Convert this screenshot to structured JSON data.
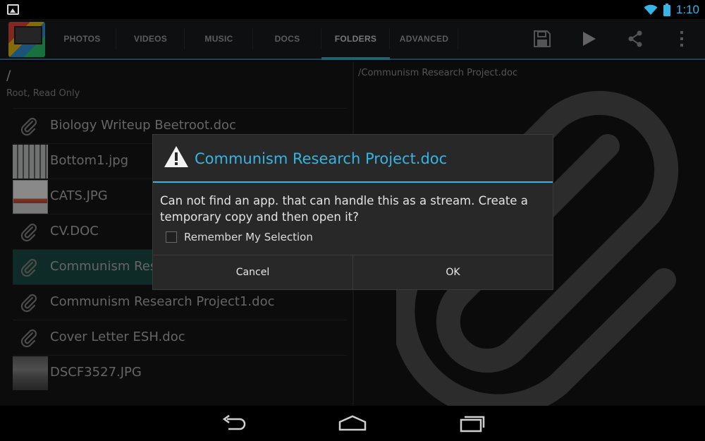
{
  "status_bar": {
    "time": "1:10",
    "icons": [
      "image-notification-icon",
      "wifi-icon",
      "battery-icon"
    ]
  },
  "action_bar": {
    "tabs": [
      {
        "label": "PHOTOS"
      },
      {
        "label": "VIDEOS"
      },
      {
        "label": "MUSIC"
      },
      {
        "label": "DOCS"
      },
      {
        "label": "FOLDERS",
        "active": true
      },
      {
        "label": "ADVANCED"
      }
    ],
    "actions": [
      "save-icon",
      "play-icon",
      "share-icon",
      "overflow-menu-icon"
    ]
  },
  "browser": {
    "path": "/",
    "path_info": "Root, Read Only",
    "files": [
      {
        "name": "Biology Writeup Beetroot.doc",
        "icon": "paperclip-icon"
      },
      {
        "name": "Bottom1.jpg",
        "icon": "thumbnail"
      },
      {
        "name": "CATS.JPG",
        "icon": "thumbnail"
      },
      {
        "name": "CV.DOC",
        "icon": "paperclip-icon"
      },
      {
        "name": "Communism Research Project.doc",
        "icon": "paperclip-icon",
        "selected": true
      },
      {
        "name": "Communism Research Project1.doc",
        "icon": "paperclip-icon"
      },
      {
        "name": "Cover Letter ESH.doc",
        "icon": "paperclip-icon"
      },
      {
        "name": "DSCF3527.JPG",
        "icon": "thumbnail"
      }
    ]
  },
  "preview": {
    "path": "/Communism Research Project.doc"
  },
  "dialog": {
    "title": "Communism Research Project.doc",
    "message": "Can not find an app. that can handle this as a stream. Create a temporary copy and then open it?",
    "remember_label": "Remember My Selection",
    "remember_checked": false,
    "cancel_label": "Cancel",
    "ok_label": "OK"
  },
  "colors": {
    "accent": "#33b5e5",
    "selected_row": "#1c4f48"
  }
}
